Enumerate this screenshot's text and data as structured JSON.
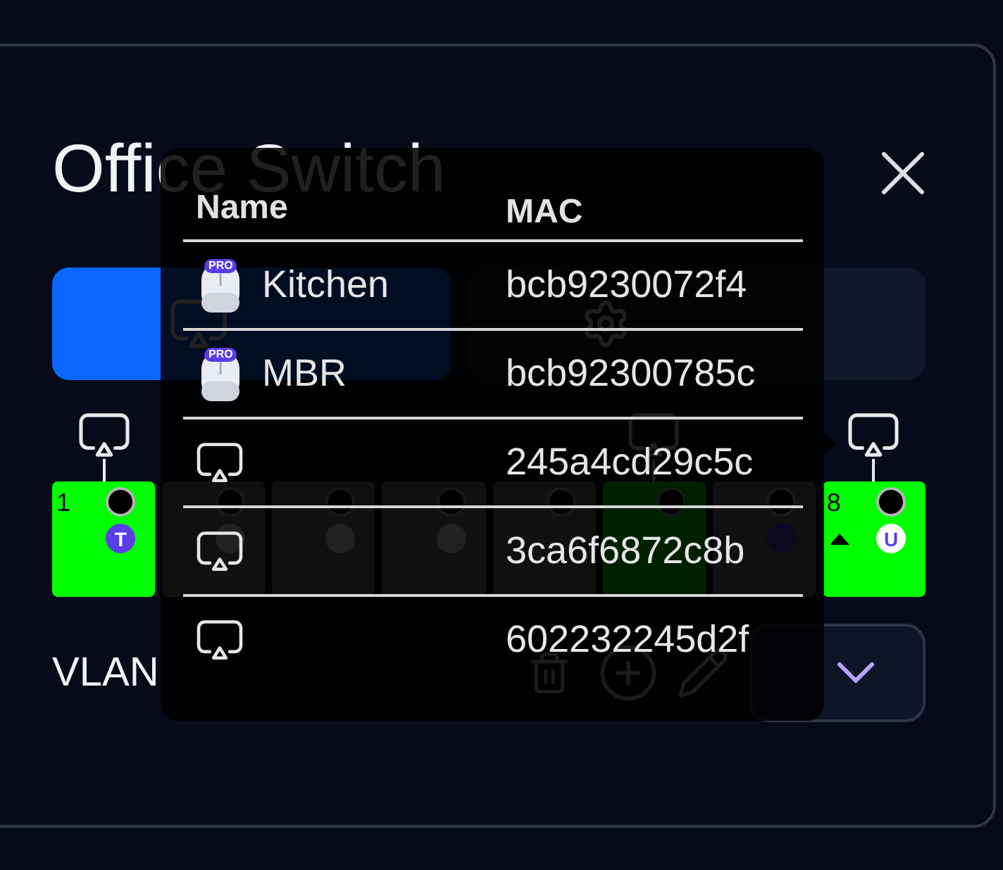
{
  "dialog": {
    "title": "Office Switch"
  },
  "tabs": [
    {
      "selected": true
    },
    {
      "selected": false
    }
  ],
  "ports": [
    {
      "number": "1",
      "active": true,
      "badge": {
        "label": "T",
        "kind": "tagged"
      },
      "client": true,
      "marker": false
    },
    {
      "active": false,
      "badge": {
        "kind": "untagged"
      },
      "client": false,
      "marker": false
    },
    {
      "active": false,
      "badge": {
        "kind": "untagged"
      },
      "client": false,
      "marker": false
    },
    {
      "active": false,
      "badge": {
        "kind": "untagged"
      },
      "client": false,
      "marker": false
    },
    {
      "active": false,
      "client": false,
      "marker": false
    },
    {
      "active": true,
      "client": true,
      "marker": false
    },
    {
      "active": false,
      "badge": {
        "kind": "tagged"
      },
      "client": false,
      "marker": false
    },
    {
      "number": "8",
      "active": true,
      "badge": {
        "label": "U",
        "kind": "untagged"
      },
      "client": true,
      "marker": true
    }
  ],
  "vlan": {
    "label": "VLAN"
  },
  "client_popover": {
    "columns": [
      "Name",
      "MAC"
    ],
    "rows": [
      {
        "kind": "pro-device",
        "badge": "PRO",
        "name": "Kitchen",
        "mac": "bcb9230072f4"
      },
      {
        "kind": "pro-device",
        "badge": "PRO",
        "name": "MBR",
        "mac": "bcb92300785c"
      },
      {
        "kind": "cast-device",
        "mac": "245a4cd29c5c"
      },
      {
        "kind": "cast-device",
        "mac": "3ca6f6872c8b"
      },
      {
        "kind": "cast-device",
        "mac": "602232245d2f"
      }
    ]
  }
}
